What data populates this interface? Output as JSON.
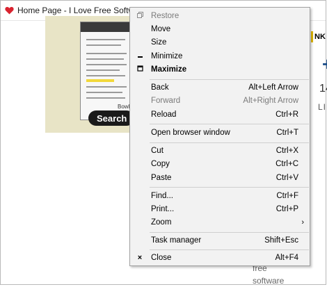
{
  "window": {
    "title": "Home Page - I Love Free Software",
    "icon": "heart-icon",
    "icon_color": "#d9232f"
  },
  "background": {
    "ad_button_label": "Search PD",
    "ad_small_text": "Bowl",
    "side_ad_text": "NK",
    "side_plus": "+",
    "side_count": "14",
    "side_label": "LIK",
    "free_text_line1": "free",
    "free_text_line2": "software"
  },
  "menu": {
    "items": [
      {
        "label": "Restore",
        "shortcut": "",
        "glyph": "restore-icon",
        "disabled": true
      },
      {
        "label": "Move",
        "shortcut": ""
      },
      {
        "label": "Size",
        "shortcut": ""
      },
      {
        "label": "Minimize",
        "shortcut": "",
        "glyph": "minimize-icon"
      },
      {
        "label": "Maximize",
        "shortcut": "",
        "glyph": "maximize-icon",
        "bold": true
      },
      {
        "label": "Back",
        "shortcut": "Alt+Left Arrow"
      },
      {
        "label": "Forward",
        "shortcut": "Alt+Right Arrow",
        "disabled": true
      },
      {
        "label": "Reload",
        "shortcut": "Ctrl+R"
      },
      {
        "label": "Open browser window",
        "shortcut": "Ctrl+T"
      },
      {
        "label": "Cut",
        "shortcut": "Ctrl+X"
      },
      {
        "label": "Copy",
        "shortcut": "Ctrl+C"
      },
      {
        "label": "Paste",
        "shortcut": "Ctrl+V"
      },
      {
        "label": "Find...",
        "shortcut": "Ctrl+F"
      },
      {
        "label": "Print...",
        "shortcut": "Ctrl+P"
      },
      {
        "label": "Zoom",
        "shortcut": "",
        "submenu": true
      },
      {
        "label": "Task manager",
        "shortcut": "Shift+Esc"
      },
      {
        "label": "Close",
        "shortcut": "Alt+F4",
        "glyph": "close-icon"
      }
    ]
  }
}
